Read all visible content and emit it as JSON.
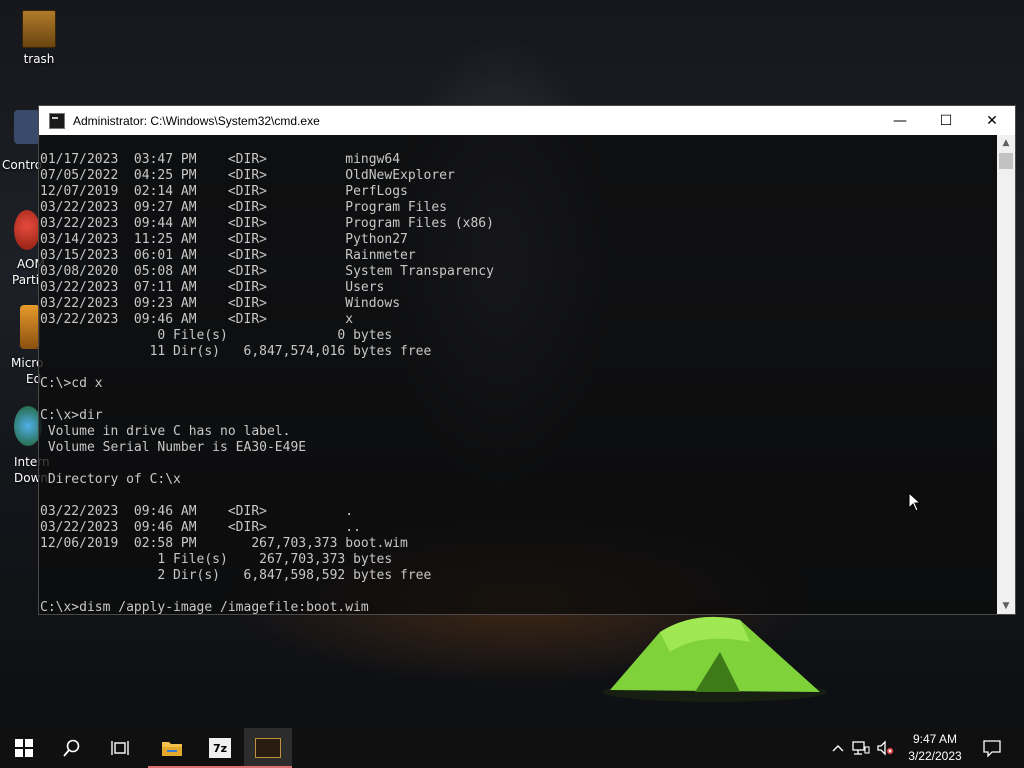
{
  "desktop": {
    "icons": [
      {
        "label": "trash"
      },
      {
        "label": "Contro"
      },
      {
        "label": "AOM"
      },
      {
        "label": "Parti"
      },
      {
        "label": "Micro"
      },
      {
        "label": "Ed"
      },
      {
        "label": "Intern"
      },
      {
        "label": "Down"
      }
    ]
  },
  "window": {
    "title": "Administrator: C:\\Windows\\System32\\cmd.exe",
    "buttons": {
      "minimize": "—",
      "maximize": "☐",
      "close": "✕"
    }
  },
  "console": {
    "lines": [
      "01/17/2023  03:47 PM    <DIR>          mingw64",
      "07/05/2022  04:25 PM    <DIR>          OldNewExplorer",
      "12/07/2019  02:14 AM    <DIR>          PerfLogs",
      "03/22/2023  09:27 AM    <DIR>          Program Files",
      "03/22/2023  09:44 AM    <DIR>          Program Files (x86)",
      "03/14/2023  11:25 AM    <DIR>          Python27",
      "03/15/2023  06:01 AM    <DIR>          Rainmeter",
      "03/08/2020  05:08 AM    <DIR>          System Transparency",
      "03/22/2023  07:11 AM    <DIR>          Users",
      "03/22/2023  09:23 AM    <DIR>          Windows",
      "03/22/2023  09:46 AM    <DIR>          x",
      "               0 File(s)              0 bytes",
      "              11 Dir(s)   6,847,574,016 bytes free",
      "",
      "C:\\>cd x",
      "",
      "C:\\x>dir",
      " Volume in drive C has no label.",
      " Volume Serial Number is EA30-E49E",
      "",
      " Directory of C:\\x",
      "",
      "03/22/2023  09:46 AM    <DIR>          .",
      "03/22/2023  09:46 AM    <DIR>          ..",
      "12/06/2019  02:58 PM       267,703,373 boot.wim",
      "               1 File(s)    267,703,373 bytes",
      "               2 Dir(s)   6,847,598,592 bytes free",
      "",
      "C:\\x>dism /apply-image /imagefile:boot.wim"
    ]
  },
  "taskbar": {
    "start_icon": "windows-logo-icon",
    "search_icon": "search-icon",
    "task_view_icon": "task-view-icon",
    "apps": [
      {
        "name": "file-explorer-icon"
      },
      {
        "name": "7zip-icon",
        "label": "7z"
      },
      {
        "name": "cmd-icon"
      }
    ],
    "tray": {
      "chevron": "^",
      "time": "9:47 AM",
      "date": "3/22/2023"
    }
  },
  "colors": {
    "accent_underline": "#e07070",
    "console_text": "#c8c8c8",
    "tent_green": "#7fd23a"
  }
}
